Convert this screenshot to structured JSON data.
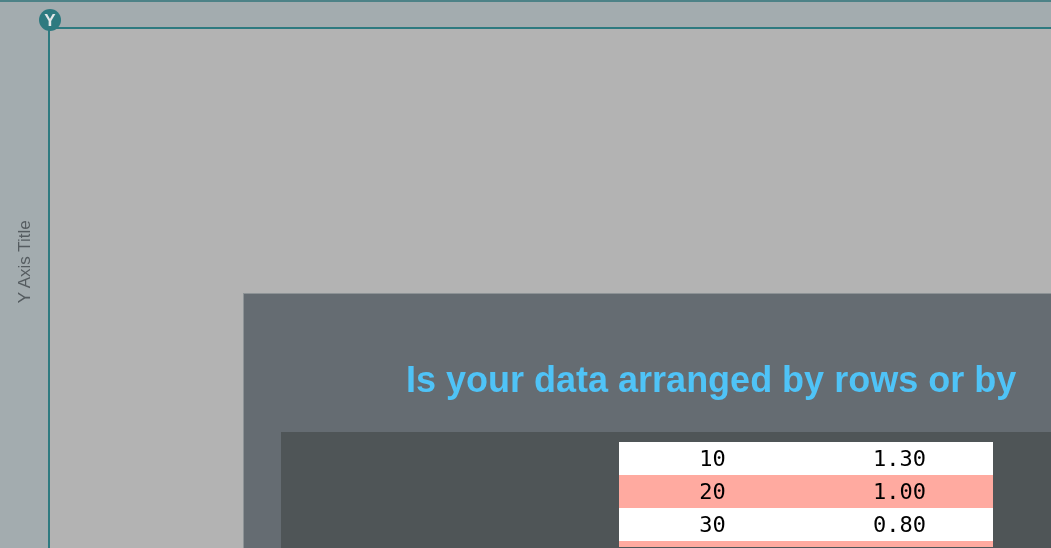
{
  "axis_marker": {
    "label": "Y"
  },
  "y_axis": {
    "title": "Y Axis Title"
  },
  "dialog": {
    "title": "Is your data arranged by rows or by",
    "rows": [
      {
        "cells": [
          "10",
          "1.30"
        ],
        "highlighted": false
      },
      {
        "cells": [
          "20",
          "1.00"
        ],
        "highlighted": true
      },
      {
        "cells": [
          "30",
          "0.80"
        ],
        "highlighted": false
      }
    ]
  }
}
